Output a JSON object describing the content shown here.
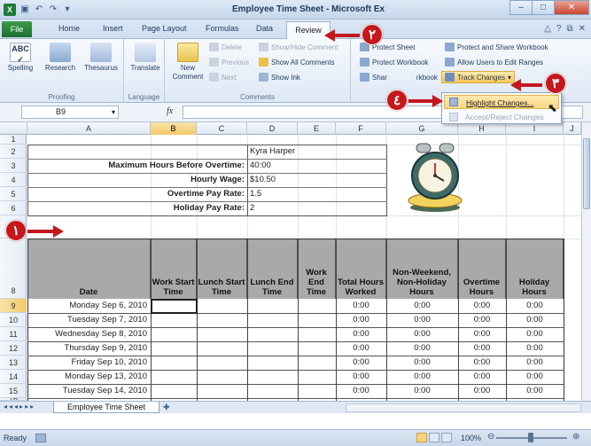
{
  "window": {
    "title": "Employee Time Sheet - Microsoft Ex",
    "controls": [
      "–",
      "□",
      "✕"
    ]
  },
  "tabs": [
    "File",
    "Home",
    "Insert",
    "Page Layout",
    "Formulas",
    "Data",
    "Review"
  ],
  "ribbon": {
    "proofing": {
      "label": "Proofing",
      "buttons": [
        "Spelling",
        "Research",
        "Thesaurus"
      ]
    },
    "language": {
      "label": "Language",
      "buttons": [
        "Translate"
      ]
    },
    "comments": {
      "label": "Comments",
      "new_comment": "New Comment",
      "delete": "Delete",
      "previous": "Previous",
      "next": "Next",
      "show_hide": "Show/Hide Comment",
      "show_all": "Show All Comments",
      "show_ink": "Show Ink"
    },
    "changes": {
      "protect_sheet": "Protect Sheet",
      "protect_workbook": "Protect Workbook",
      "share_workbook": "Share Workbook",
      "share_visible": "Shar",
      "share_tail": "rkbook",
      "protect_share": "Protect and Share Workbook",
      "allow_edit": "Allow Users to Edit Ranges",
      "track_changes": "Track Changes"
    }
  },
  "dropdown": {
    "items": [
      "Highlight Changes...",
      "Accept/Reject Changes"
    ]
  },
  "formula_bar": {
    "name_box": "B9",
    "fx": "fx"
  },
  "columns": [
    "A",
    "B",
    "C",
    "D",
    "E",
    "F",
    "G",
    "H",
    "I",
    "J"
  ],
  "rows": [
    "1",
    "2",
    "3",
    "4",
    "5",
    "6",
    "7",
    "8",
    "9",
    "10",
    "11",
    "12",
    "13",
    "14",
    "15",
    "16"
  ],
  "info": {
    "employee": "Kyra Harper",
    "labels": [
      "Maximum Hours Before Overtime:",
      "Hourly Wage:",
      "Overtime Pay Rate:",
      "Holiday Pay Rate:"
    ],
    "values": [
      "40:00",
      "$10.50",
      "1.5",
      "2"
    ]
  },
  "table": {
    "headers": [
      "Date",
      "Work Start Time",
      "Lunch Start Time",
      "Lunch End Time",
      "Work End Time",
      "Total Hours Worked",
      "Non-Weekend, Non-Holiday Hours",
      "Overtime Hours",
      "Holiday Hours"
    ],
    "rows": [
      [
        "Monday Sep 6, 2010",
        "0:00",
        "0:00",
        "0:00",
        "0:00"
      ],
      [
        "Tuesday Sep 7, 2010",
        "0:00",
        "0:00",
        "0:00",
        "0:00"
      ],
      [
        "Wednesday Sep 8, 2010",
        "0:00",
        "0:00",
        "0:00",
        "0:00"
      ],
      [
        "Thursday Sep 9, 2010",
        "0:00",
        "0:00",
        "0:00",
        "0:00"
      ],
      [
        "Friday Sep 10, 2010",
        "0:00",
        "0:00",
        "0:00",
        "0:00"
      ],
      [
        "Monday Sep 13, 2010",
        "0:00",
        "0:00",
        "0:00",
        "0:00"
      ],
      [
        "Tuesday Sep 14, 2010",
        "0:00",
        "0:00",
        "0:00",
        "0:00"
      ]
    ]
  },
  "sheet_tab": "Employee Time Sheet",
  "status": {
    "ready": "Ready",
    "zoom": "100%"
  },
  "callouts": [
    "١",
    "٢",
    "٣",
    "٤"
  ],
  "colors": {
    "accent": "#c5171c",
    "file_tab": "#1f7a3a",
    "table_header": "#a9a9a9"
  }
}
